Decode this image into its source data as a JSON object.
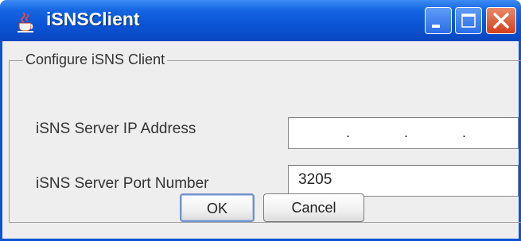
{
  "window": {
    "title": "iSNSClient",
    "icon": "java-cup-icon"
  },
  "group": {
    "legend": "Configure iSNS Client"
  },
  "fields": {
    "ip_label": "iSNS Server IP Address",
    "ip_value": "",
    "ip_separators": [
      ".",
      ".",
      "."
    ],
    "port_label": "iSNS Server Port Number",
    "port_value": "3205"
  },
  "buttons": {
    "ok": "OK",
    "cancel": "Cancel"
  },
  "colors": {
    "titlebar": "#0b54d4",
    "close": "#d2401a",
    "panel": "#eeeeee"
  }
}
